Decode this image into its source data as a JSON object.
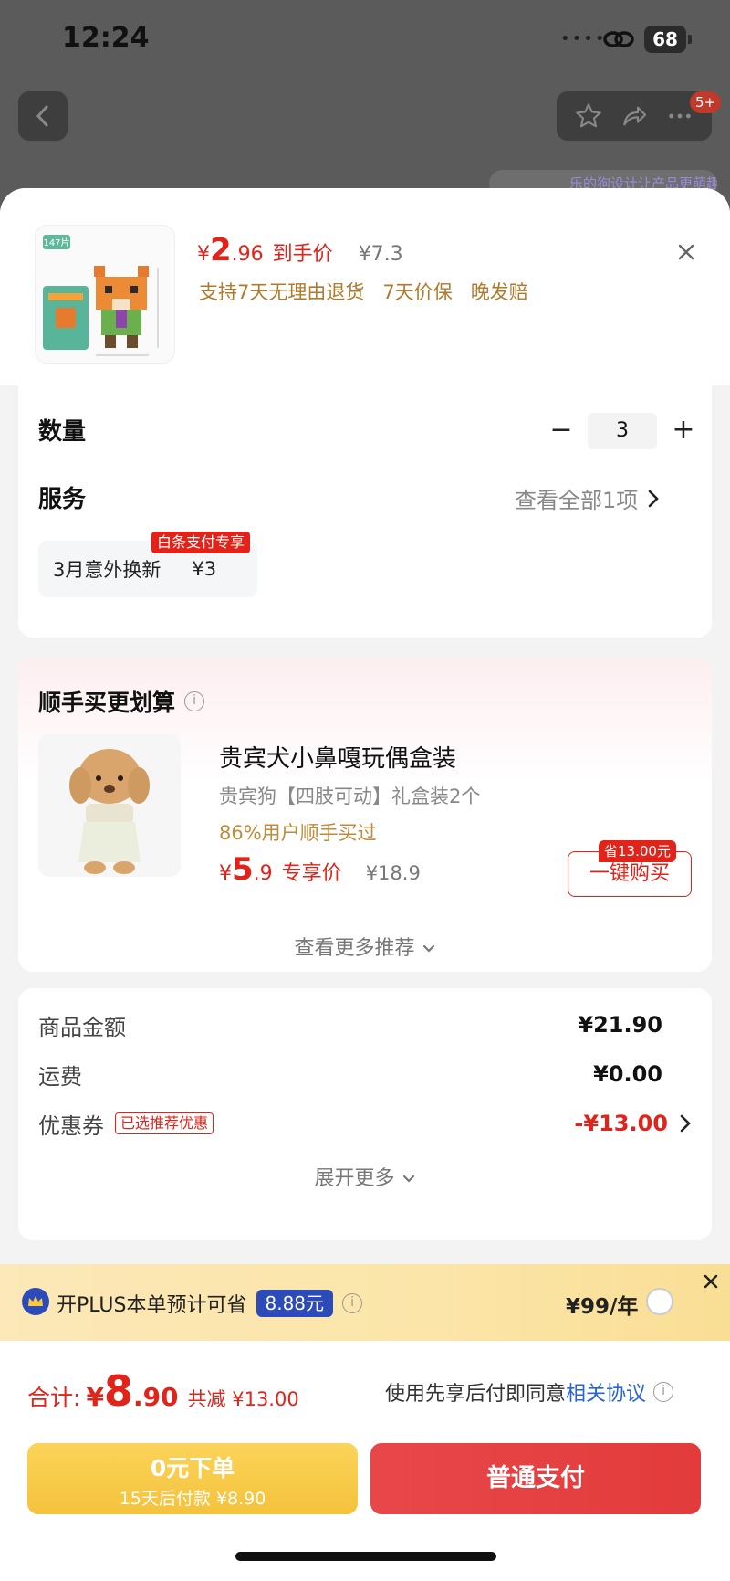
{
  "status_bar": {
    "time": "12:24",
    "battery": "68"
  },
  "nav": {
    "badge": "5+",
    "promo_text": "乐的狗设计让产品更萌趣"
  },
  "product": {
    "price_yen": "¥",
    "price_int": "2",
    "price_dec": ".96",
    "price_label": "到手价",
    "original_price": "¥7.3",
    "thumb_count": "147片",
    "perks": [
      "支持7天无理由退货",
      "7天价保",
      "晚发赔"
    ]
  },
  "quantity": {
    "label": "数量",
    "value": "3",
    "minus": "−",
    "plus": "+"
  },
  "service": {
    "label": "服务",
    "view_all": "查看全部1项",
    "chip_name": "3月意外换新",
    "chip_price": "¥3",
    "chip_tag": "白条支付专享"
  },
  "recommend": {
    "title": "顺手买更划算",
    "info": "i",
    "item": {
      "name": "贵宾犬小鼻嘎玩偶盒装",
      "desc": "贵宾狗【四肢可动】礼盒装2个",
      "bought": "86%用户顺手买过",
      "price_yen": "¥",
      "price_int": "5",
      "price_dec": ".9",
      "price_label": "专享价",
      "original_price": "¥18.9",
      "save_tag": "省13.00元",
      "buy_label": "一键购买"
    },
    "see_more": "查看更多推荐"
  },
  "totals": {
    "rows": [
      {
        "label": "商品金额",
        "value": "¥21.90"
      },
      {
        "label": "运费",
        "value": "¥0.00"
      },
      {
        "label": "优惠券",
        "tag": "已选推荐优惠",
        "value": "-¥13.00"
      }
    ],
    "expand": "展开更多"
  },
  "plus": {
    "text": "开PLUS本单预计可省",
    "amount": "8.88元",
    "price": "¥99/年"
  },
  "checkout": {
    "total_label": "合计:",
    "total_yen": "¥",
    "total_int": "8",
    "total_dec": ".90",
    "saved": "共减 ¥13.00",
    "agreement_prefix": "使用先享后付即同意",
    "agreement_link": "相关协议",
    "pay_later_line1": "0元下单",
    "pay_later_line2": "15天后付款 ¥8.90",
    "pay_normal": "普通支付"
  },
  "colors": {
    "accent": "#e2231a",
    "gold": "#b07a2c",
    "plus_blue": "#2c4bb8",
    "pay_later": "#f5c23c"
  }
}
